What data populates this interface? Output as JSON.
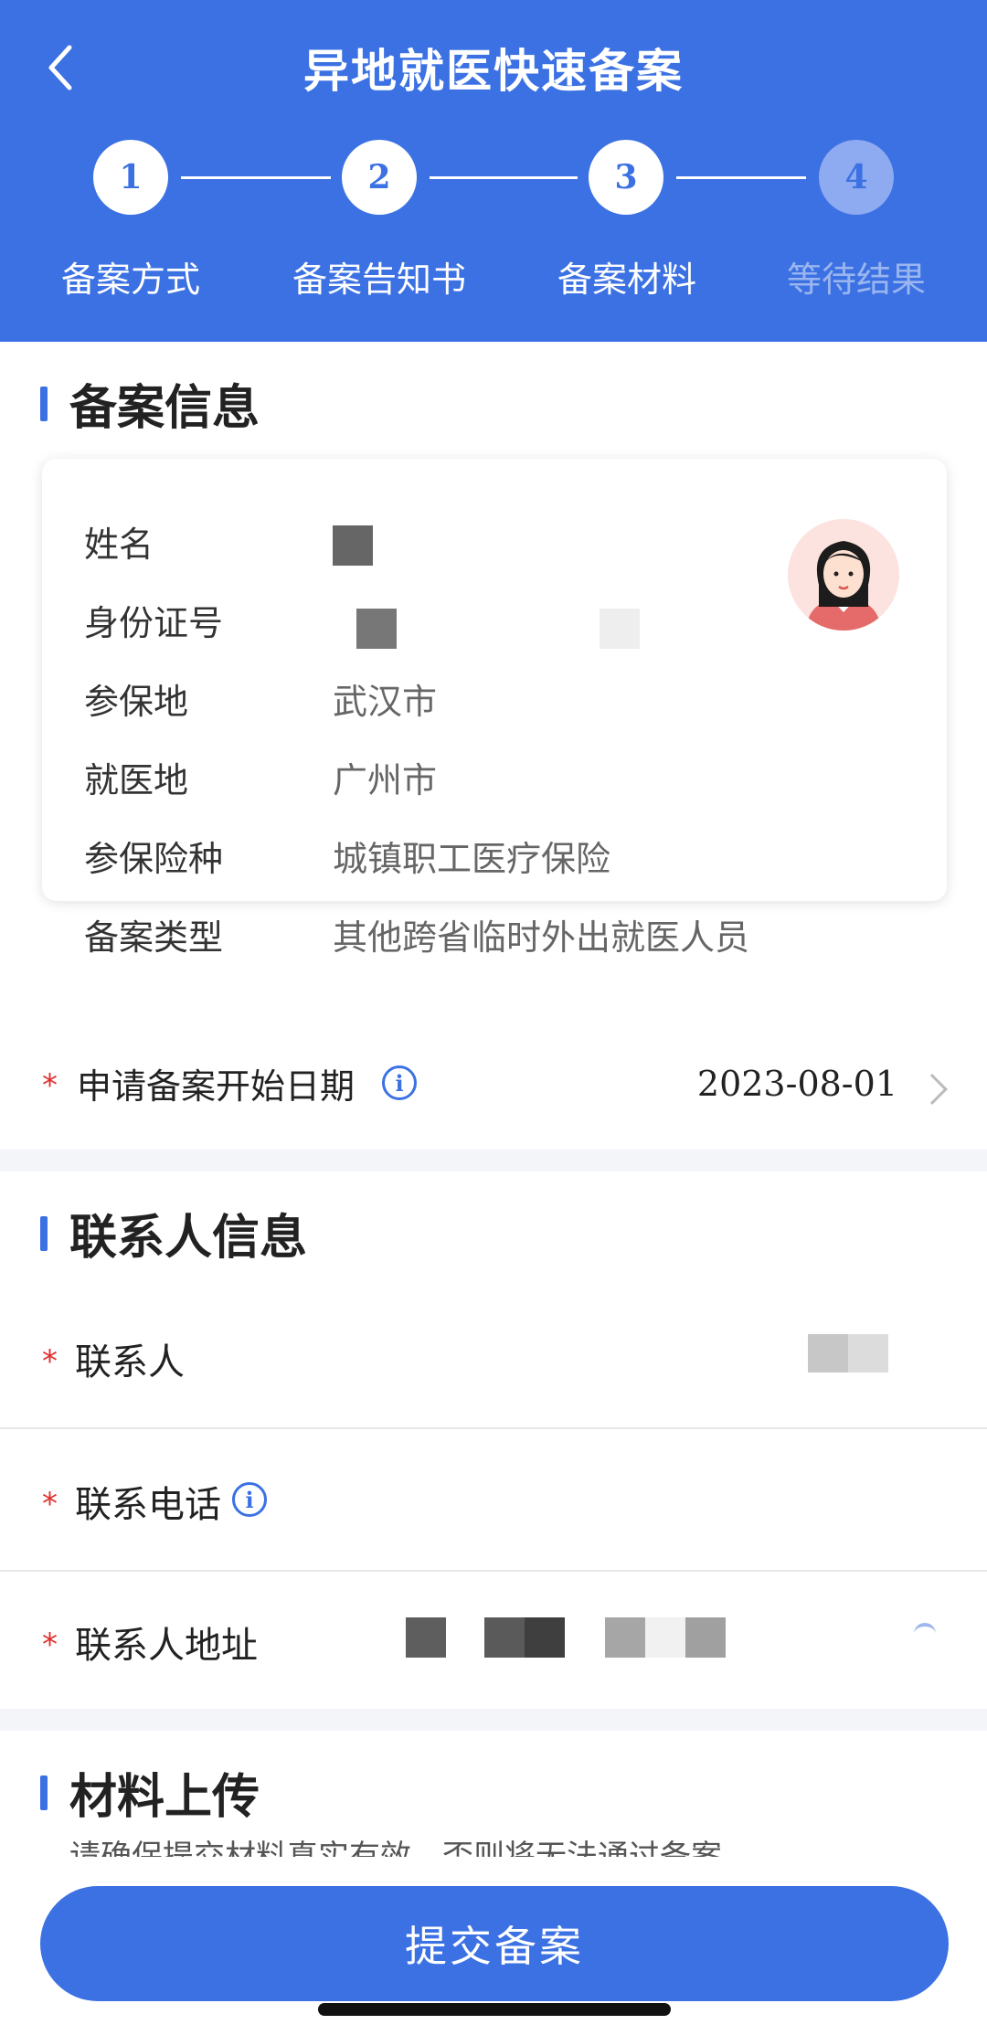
{
  "header": {
    "title": "异地就医快速备案",
    "steps": [
      {
        "number": "1",
        "label": "备案方式",
        "active": true
      },
      {
        "number": "2",
        "label": "备案告知书",
        "active": true
      },
      {
        "number": "3",
        "label": "备案材料",
        "active": true
      },
      {
        "number": "4",
        "label": "等待结果",
        "active": false
      }
    ]
  },
  "filing_info": {
    "title": "备案信息",
    "rows": [
      {
        "label": "姓名",
        "value": ""
      },
      {
        "label": "身份证号",
        "value": ""
      },
      {
        "label": "参保地",
        "value": "武汉市"
      },
      {
        "label": "就医地",
        "value": "广州市"
      },
      {
        "label": "参保险种",
        "value": "城镇职工医疗保险"
      },
      {
        "label": "备案类型",
        "value": "其他跨省临时外出就医人员"
      }
    ],
    "start_date": {
      "required_mark": "*",
      "label": "申请备案开始日期",
      "info_glyph": "i",
      "value": "2023-08-01"
    }
  },
  "contact_info": {
    "title": "联系人信息",
    "rows": [
      {
        "required_mark": "*",
        "label": "联系人",
        "info_glyph": ""
      },
      {
        "required_mark": "*",
        "label": "联系电话",
        "info_glyph": "i"
      },
      {
        "required_mark": "*",
        "label": "联系人地址",
        "info_glyph": ""
      }
    ]
  },
  "materials": {
    "title": "材料上传",
    "note": "请确保提交材料真实有效，否则将无法通过备案"
  },
  "submit_label": "提交备案",
  "colors": {
    "accent": "#3b71e3",
    "required": "#e0302d"
  }
}
